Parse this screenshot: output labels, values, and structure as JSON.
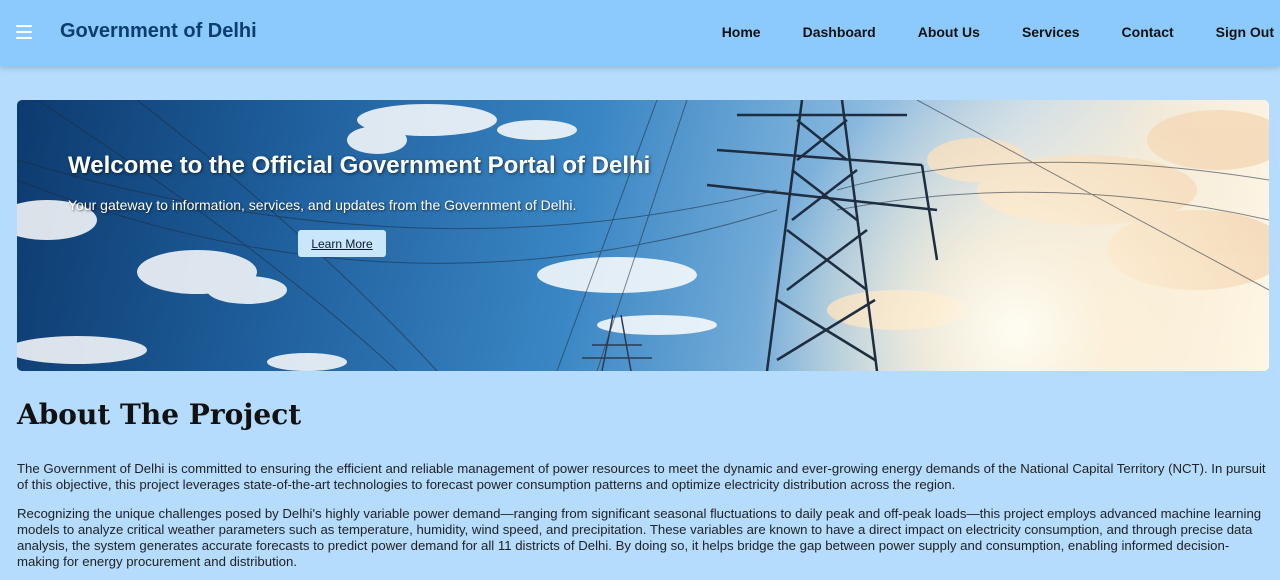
{
  "header": {
    "brand": "Government of Delhi",
    "nav": [
      "Home",
      "Dashboard",
      "About Us",
      "Services",
      "Contact",
      "Sign Out"
    ]
  },
  "hero": {
    "title": "Welcome to the Official Government Portal of Delhi",
    "subtitle": "Your gateway to information, services, and updates from the Government of Delhi.",
    "button": "Learn More"
  },
  "about": {
    "title": "About The Project",
    "paragraphs": [
      "The Government of Delhi is committed to ensuring the efficient and reliable management of power resources to meet the dynamic and ever-growing energy demands of the National Capital Territory (NCT). In pursuit of this objective, this project leverages state-of-the-art technologies to forecast power consumption patterns and optimize electricity distribution across the region.",
      "Recognizing the unique challenges posed by Delhi's highly variable power demand—ranging from significant seasonal fluctuations to daily peak and off-peak loads—this project employs advanced machine learning models to analyze critical weather parameters such as temperature, humidity, wind speed, and precipitation. These variables are known to have a direct impact on electricity consumption, and through precise data analysis, the system generates accurate forecasts to predict power demand for all 11 districts of Delhi. By doing so, it helps bridge the gap between power supply and consumption, enabling informed decision-making for energy procurement and distribution."
    ]
  },
  "colors": {
    "navbar": "#8ccafd",
    "page_bg": "#b5dcfd",
    "brand_text": "#0b3d6e",
    "button_bg": "#c9e6fb"
  },
  "icons": {
    "menu": "hamburger-menu-icon"
  }
}
